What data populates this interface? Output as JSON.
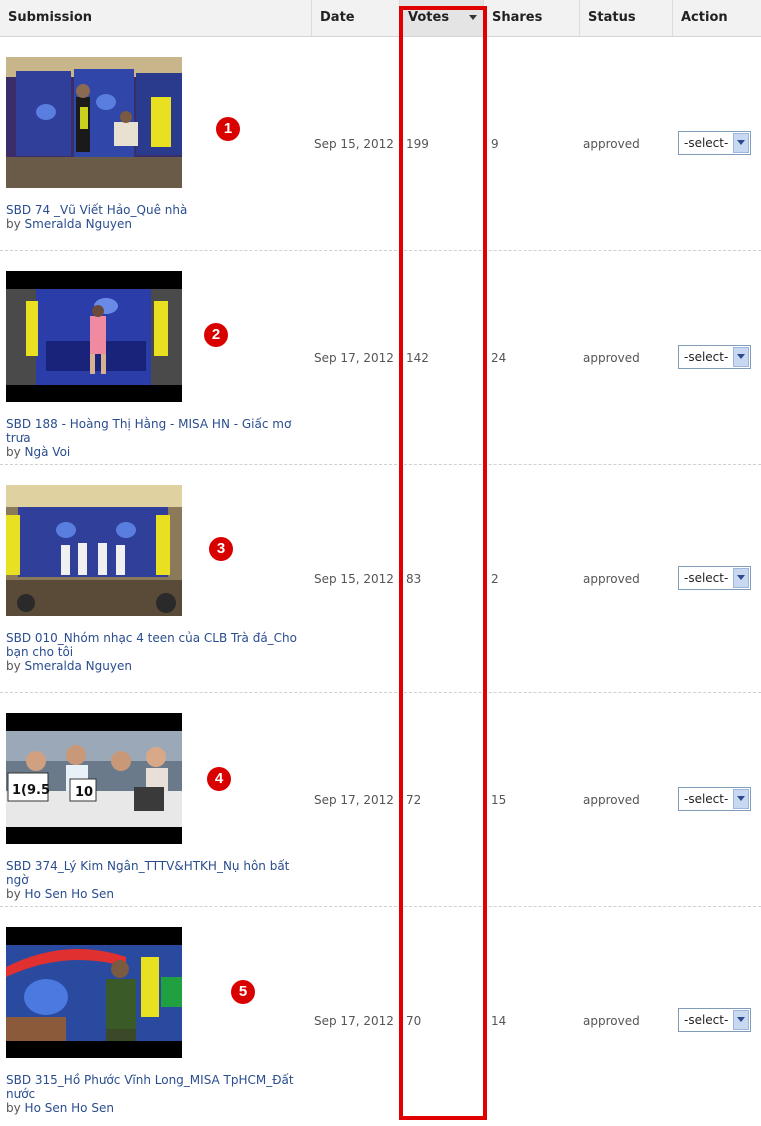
{
  "columns": {
    "submission": "Submission",
    "date": "Date",
    "votes": "Votes",
    "shares": "Shares",
    "status": "Status",
    "action": "Action"
  },
  "rows": [
    {
      "number": "1",
      "title": "SBD 74 _Vũ Viết Hảo_Quê nhà",
      "by": "by",
      "author": "Smeralda Nguyen",
      "date": "Sep 15, 2012",
      "votes": "199",
      "shares": "9",
      "status": "approved",
      "action": "-select-"
    },
    {
      "number": "2",
      "title": "SBD 188 - Hoàng Thị Hằng - MISA HN - Giấc mơ trưa",
      "by": "by",
      "author": "Ngà Voi",
      "date": "Sep 17, 2012",
      "votes": "142",
      "shares": "24",
      "status": "approved",
      "action": "-select-"
    },
    {
      "number": "3",
      "title": "SBD 010_Nhóm nhạc 4 teen của CLB Trà đá_Cho bạn cho tôi",
      "by": "by",
      "author": "Smeralda Nguyen",
      "date": "Sep 15, 2012",
      "votes": "83",
      "shares": "2",
      "status": "approved",
      "action": "-select-"
    },
    {
      "number": "4",
      "title": "SBD 374_Lý Kim Ngân_TTTV&HTKH_Nụ hôn bất ngờ",
      "by": "by",
      "author": "Ho Sen Ho Sen",
      "date": "Sep 17, 2012",
      "votes": "72",
      "shares": "15",
      "status": "approved",
      "action": "-select-"
    },
    {
      "number": "5",
      "title": "SBD 315_Hồ Phước Vĩnh Long_MISA TpHCM_Đất nước",
      "by": "by",
      "author": "Ho Sen Ho Sen",
      "date": "Sep 17, 2012",
      "votes": "70",
      "shares": "14",
      "status": "approved",
      "action": "-select-"
    }
  ],
  "thumb_text": {
    "row4_card1": "1(9.5",
    "row4_card2": "10"
  },
  "colors": {
    "highlight": "#e00000",
    "link": "#2a4d8f",
    "badge": "#d90000"
  }
}
